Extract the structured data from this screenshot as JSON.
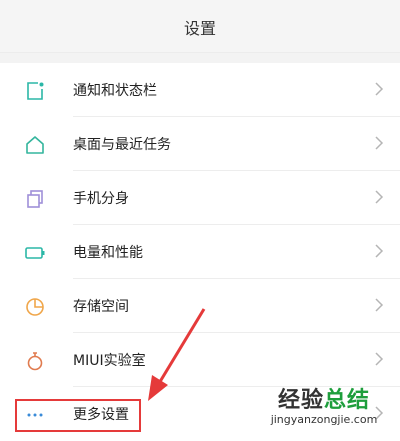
{
  "header": {
    "title": "设置"
  },
  "items": [
    {
      "label": "通知和状态栏",
      "icon": "notification-icon",
      "icon_color": "#2bb7a7"
    },
    {
      "label": "桌面与最近任务",
      "icon": "home-icon",
      "icon_color": "#34b59d"
    },
    {
      "label": "手机分身",
      "icon": "clone-icon",
      "icon_color": "#9f8fd8"
    },
    {
      "label": "电量和性能",
      "icon": "battery-icon",
      "icon_color": "#2bb7a7"
    },
    {
      "label": "存储空间",
      "icon": "pie-chart-icon",
      "icon_color": "#f0a64a"
    },
    {
      "label": "MIUI实验室",
      "icon": "flask-icon",
      "icon_color": "#e07b4f"
    },
    {
      "label": "更多设置",
      "icon": "more-icon",
      "icon_color": "#3a8bd8"
    }
  ],
  "annotation": {
    "highlight_color": "#e53a3a"
  },
  "watermark": {
    "title_part1": "经验",
    "title_part2": "总结",
    "url": "jingyanzongjie.com",
    "accent_color": "#1e9e3c"
  }
}
